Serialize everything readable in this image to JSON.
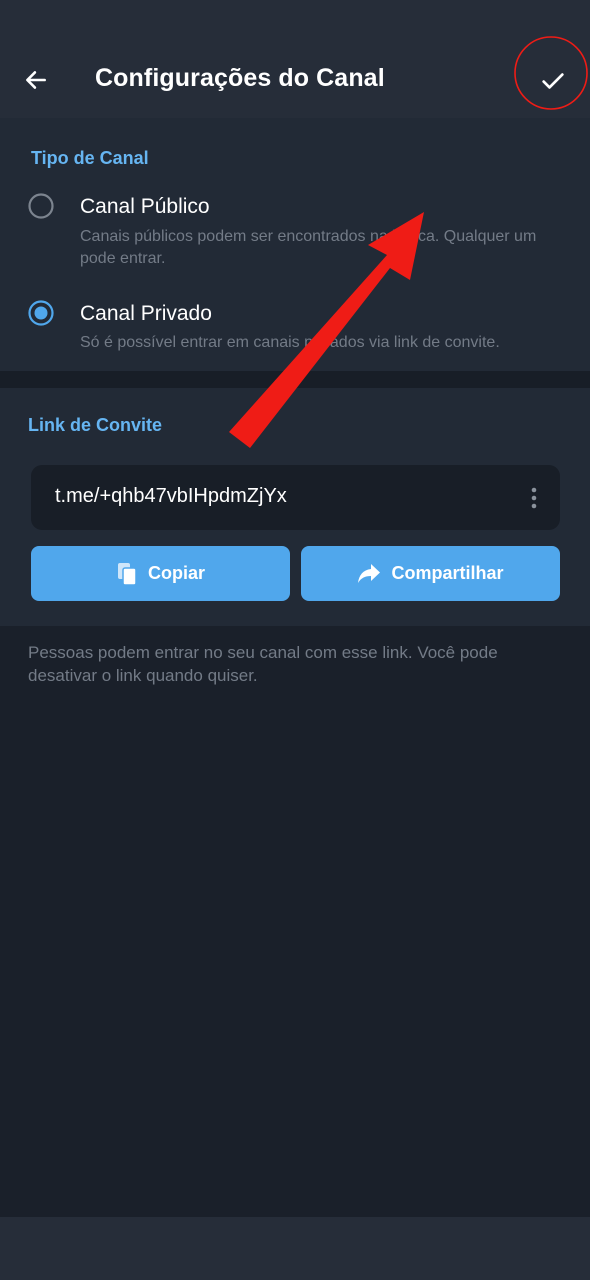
{
  "header": {
    "title": "Configurações do Canal",
    "back_icon": "arrow-left-icon",
    "done_icon": "checkmark-icon"
  },
  "channel_type": {
    "section_title": "Tipo de Canal",
    "options": [
      {
        "title": "Canal Público",
        "description": "Canais públicos podem ser encontrados na busca. Qualquer um pode entrar.",
        "selected": false
      },
      {
        "title": "Canal Privado",
        "description": "Só é possível entrar em canais privados via link de convite.",
        "selected": true
      }
    ]
  },
  "invite": {
    "section_title": "Link de Convite",
    "link": "t.me/+qhb47vbIHpdmZjYx",
    "copy_label": "Copiar",
    "share_label": "Compartilhar",
    "footer": "Pessoas podem entrar no seu canal com esse link. Você pode desativar o link quando quiser."
  },
  "colors": {
    "accent": "#50a7ec",
    "section_title": "#66b5f2",
    "background": "#1a202a",
    "surface": "#222a36",
    "annotation": "#ef1c16"
  }
}
